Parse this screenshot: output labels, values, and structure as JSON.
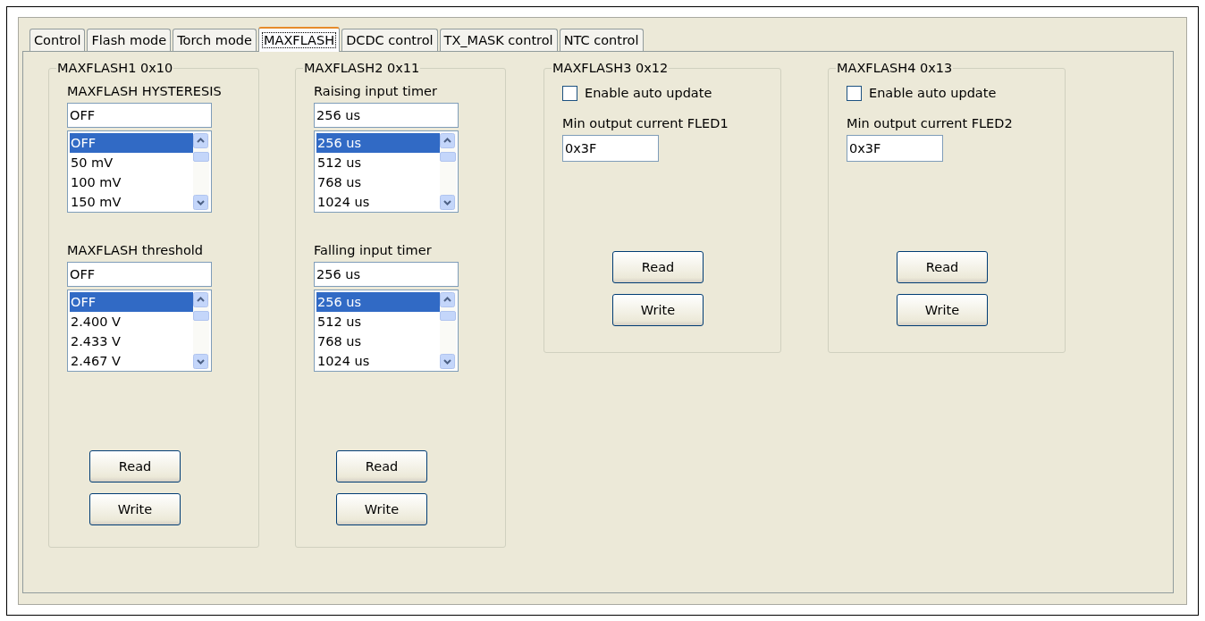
{
  "tabs": [
    {
      "label": "Control",
      "selected": false
    },
    {
      "label": "Flash mode",
      "selected": false
    },
    {
      "label": "Torch mode",
      "selected": false
    },
    {
      "label": "MAXFLASH",
      "selected": true
    },
    {
      "label": "DCDC control",
      "selected": false
    },
    {
      "label": "TX_MASK control",
      "selected": false
    },
    {
      "label": "NTC control",
      "selected": false
    }
  ],
  "groups": [
    {
      "title": "MAXFLASH1 0x10",
      "kind": "lists",
      "fields": [
        {
          "label": "MAXFLASH HYSTERESIS",
          "value": "OFF",
          "options": [
            {
              "text": "OFF",
              "selected": true
            },
            {
              "text": "50 mV",
              "selected": false
            },
            {
              "text": "100 mV",
              "selected": false
            },
            {
              "text": "150 mV",
              "selected": false
            }
          ]
        },
        {
          "label": "MAXFLASH threshold",
          "value": "OFF",
          "options": [
            {
              "text": "OFF",
              "selected": true
            },
            {
              "text": "2.400 V",
              "selected": false
            },
            {
              "text": "2.433 V",
              "selected": false
            },
            {
              "text": "2.467 V",
              "selected": false
            }
          ]
        }
      ],
      "buttons": [
        "Read",
        "Write"
      ]
    },
    {
      "title": "MAXFLASH2 0x11",
      "kind": "lists",
      "fields": [
        {
          "label": "Raising input timer",
          "value": "256 us",
          "options": [
            {
              "text": "256 us",
              "selected": true
            },
            {
              "text": "512 us",
              "selected": false
            },
            {
              "text": "768 us",
              "selected": false
            },
            {
              "text": "1024 us",
              "selected": false
            }
          ]
        },
        {
          "label": "Falling input timer",
          "value": "256 us",
          "options": [
            {
              "text": "256 us",
              "selected": true
            },
            {
              "text": "512 us",
              "selected": false
            },
            {
              "text": "768 us",
              "selected": false
            },
            {
              "text": "1024 us",
              "selected": false
            }
          ]
        }
      ],
      "buttons": [
        "Read",
        "Write"
      ]
    },
    {
      "title": "MAXFLASH3 0x12",
      "kind": "auto",
      "checkbox": {
        "label": "Enable auto update",
        "checked": false
      },
      "field_label": "Min output current FLED1",
      "value": "0x3F",
      "buttons": [
        "Read",
        "Write"
      ]
    },
    {
      "title": "MAXFLASH4 0x13",
      "kind": "auto",
      "checkbox": {
        "label": "Enable auto update",
        "checked": false
      },
      "field_label": "Min output current FLED2",
      "value": "0x3F",
      "buttons": [
        "Read",
        "Write"
      ]
    }
  ]
}
